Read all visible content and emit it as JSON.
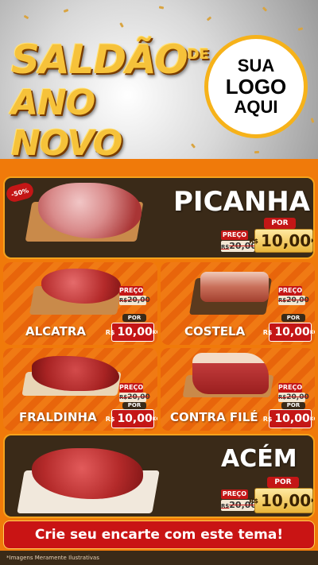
{
  "header": {
    "title_line1": "SALDÃO",
    "title_de": "DE",
    "title_line2": "ANO NOVO",
    "logo_line1": "SUA",
    "logo_line2": "LOGO",
    "logo_line3": "AQUI"
  },
  "discount_badge": "-50%",
  "products": [
    {
      "name": "PICANHA",
      "preco_label": "PREÇO",
      "old_price": "20,00",
      "old_prefix": "R$",
      "por_label": "POR",
      "currency": "R$",
      "price": "10,00",
      "unit": "KG"
    },
    {
      "name": "ALCATRA",
      "preco_label": "PREÇO",
      "old_price": "20,00",
      "old_prefix": "R$",
      "por_label": "POR",
      "currency": "R$",
      "price": "10,00",
      "unit": "KG"
    },
    {
      "name": "COSTELA",
      "preco_label": "PREÇO",
      "old_price": "20,00",
      "old_prefix": "R$",
      "por_label": "POR",
      "currency": "R$",
      "price": "10,00",
      "unit": "KG"
    },
    {
      "name": "FRALDINHA",
      "preco_label": "PREÇO",
      "old_price": "20,00",
      "old_prefix": "R$",
      "por_label": "POR",
      "currency": "R$",
      "price": "10,00",
      "unit": "KG"
    },
    {
      "name": "CONTRA FILÉ",
      "preco_label": "PREÇO",
      "old_price": "20,00",
      "old_prefix": "R$",
      "por_label": "POR",
      "currency": "R$",
      "price": "10,00",
      "unit": "KG"
    },
    {
      "name": "ACÉM",
      "preco_label": "PREÇO",
      "old_price": "20,00",
      "old_prefix": "R$",
      "por_label": "POR",
      "currency": "R$",
      "price": "10,00",
      "unit": "KG"
    }
  ],
  "cta": "Crie seu encarte com este tema!",
  "footer_note": "*Imagens Meramente Ilustrativas",
  "colors": {
    "accent_red": "#c41616",
    "orange": "#f07a0a",
    "gold": "#f6c23a",
    "dark": "#3a2a18"
  }
}
